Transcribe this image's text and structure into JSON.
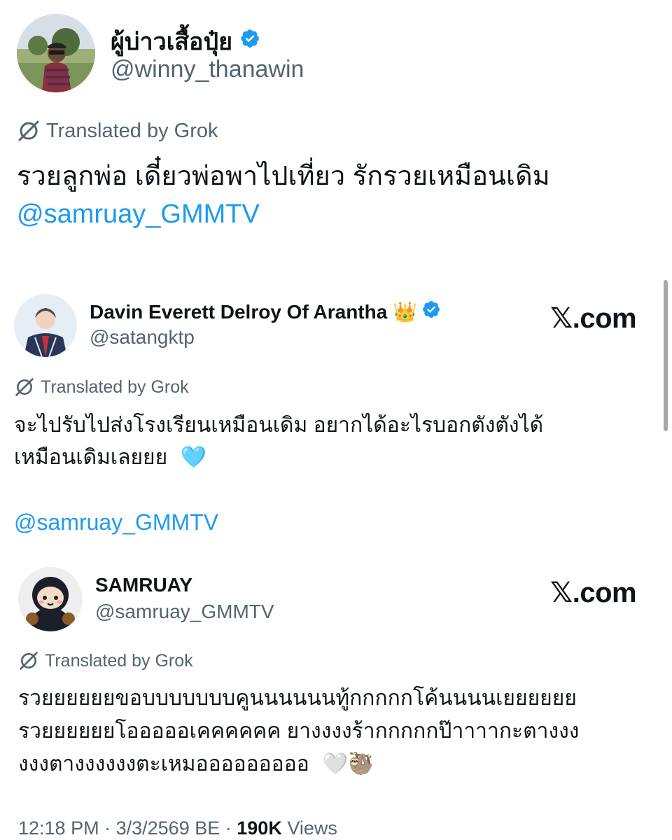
{
  "main_post": {
    "author_name": "ผู้บ่าวเสื้อปุ๋ย",
    "handle": "@winny_thanawin",
    "translated_label": "Translated by Grok",
    "text": "รวยลูกพ่อ เดี๋ยวพ่อพาไปเที่ยว รักรวยเหมือนเดิม",
    "mention": "@samruay_GMMTV"
  },
  "quote_1": {
    "author_name": "Davin Everett Delroy Of Arantha",
    "badge_emoji": "👑",
    "handle": "@satangktp",
    "source": "𝕏.com",
    "translated_label": "Translated by Grok",
    "line1": "จะไปรับไปส่งโรงเรียนเหมือนเดิม อยากได้อะไรบอกตังตังได้",
    "line2": "เหมือนเดิมเลยยย",
    "heart_emoji": "🩵",
    "mention": "@samruay_GMMTV"
  },
  "quote_2": {
    "author_name": "SAMRUAY",
    "handle": "@samruay_GMMTV",
    "source": "𝕏.com",
    "translated_label": "Translated by Grok",
    "line1": "รวยยยยยยขอบบบบบบบคูนนนนนนทู้กกกกกโค้นนนนเยยยยยย",
    "line2": "รวยยยยยยโอออออเคคคคคค ยางงงงร้ากกกกกป๊าาาากะตางงง",
    "line3": "งงงตางงงงงงตะเหมอออออออออ",
    "emojis": "🤍🦥"
  },
  "footer": {
    "time": "12:18 PM",
    "separator": "·",
    "date": "3/3/2569 BE",
    "views_count": "190K",
    "views_label": "Views"
  },
  "colors": {
    "accent": "#1d9bf0",
    "muted": "#536471",
    "text": "#0f1419"
  }
}
